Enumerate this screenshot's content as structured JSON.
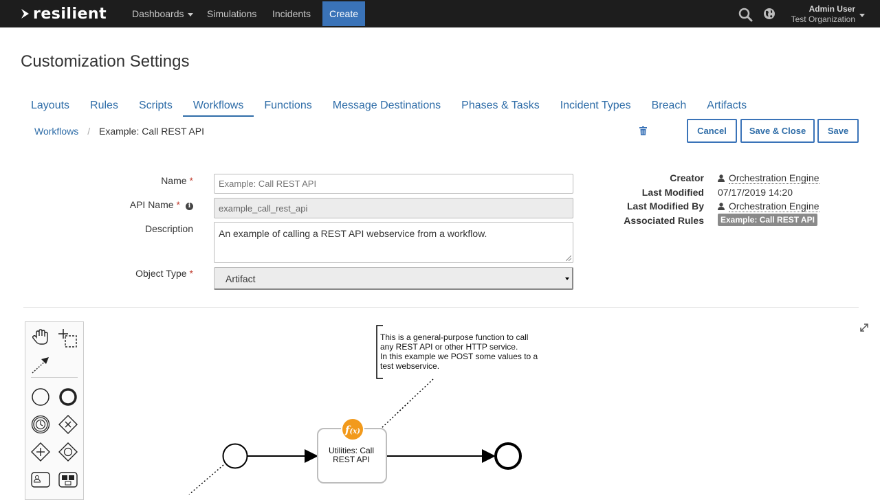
{
  "app": {
    "logo_text": "resilient"
  },
  "nav": {
    "dashboards": "Dashboards",
    "simulations": "Simulations",
    "incidents": "Incidents",
    "create": "Create",
    "user_name": "Admin User",
    "user_org": "Test Organization"
  },
  "page": {
    "title": "Customization Settings"
  },
  "tabs": [
    {
      "label": "Layouts"
    },
    {
      "label": "Rules"
    },
    {
      "label": "Scripts"
    },
    {
      "label": "Workflows",
      "active": true
    },
    {
      "label": "Functions"
    },
    {
      "label": "Message Destinations"
    },
    {
      "label": "Phases & Tasks"
    },
    {
      "label": "Incident Types"
    },
    {
      "label": "Breach"
    },
    {
      "label": "Artifacts"
    }
  ],
  "breadcrumb": {
    "parent": "Workflows",
    "current": "Example: Call REST API"
  },
  "actions": {
    "cancel": "Cancel",
    "save_close": "Save & Close",
    "save": "Save"
  },
  "form": {
    "name_label": "Name",
    "name_placeholder": "Example: Call REST API",
    "api_label": "API Name",
    "api_value": "example_call_rest_api",
    "desc_label": "Description",
    "desc_value": "An example of calling a REST API webservice from a workflow.",
    "object_label": "Object Type",
    "object_value": "Artifact"
  },
  "meta": {
    "creator_label": "Creator",
    "creator_value": "Orchestration Engine",
    "modified_label": "Last Modified",
    "modified_value": "07/17/2019 14:20",
    "modified_by_label": "Last Modified By",
    "modified_by_value": "Orchestration Engine",
    "rules_label": "Associated Rules",
    "rules_value": "Example: Call REST API"
  },
  "diagram": {
    "annotation": [
      "This is a general-purpose function to call",
      "any REST API or other HTTP service.",
      "In this example we POST some values to a",
      "test webservice."
    ],
    "task_label": "Utilities: Call REST API",
    "fx_main": "f",
    "fx_sub": "(x)"
  },
  "colors": {
    "accent": "#3a73b8",
    "topbar": "#1d1d1d",
    "fx": "#f29a1c",
    "tag": "#8a8a8a"
  },
  "icons": [
    "search-icon",
    "globe-icon",
    "trash-icon",
    "info-icon",
    "person-icon",
    "hand-tool-icon",
    "lasso-tool-icon",
    "connect-tool-icon",
    "expand-icon"
  ]
}
